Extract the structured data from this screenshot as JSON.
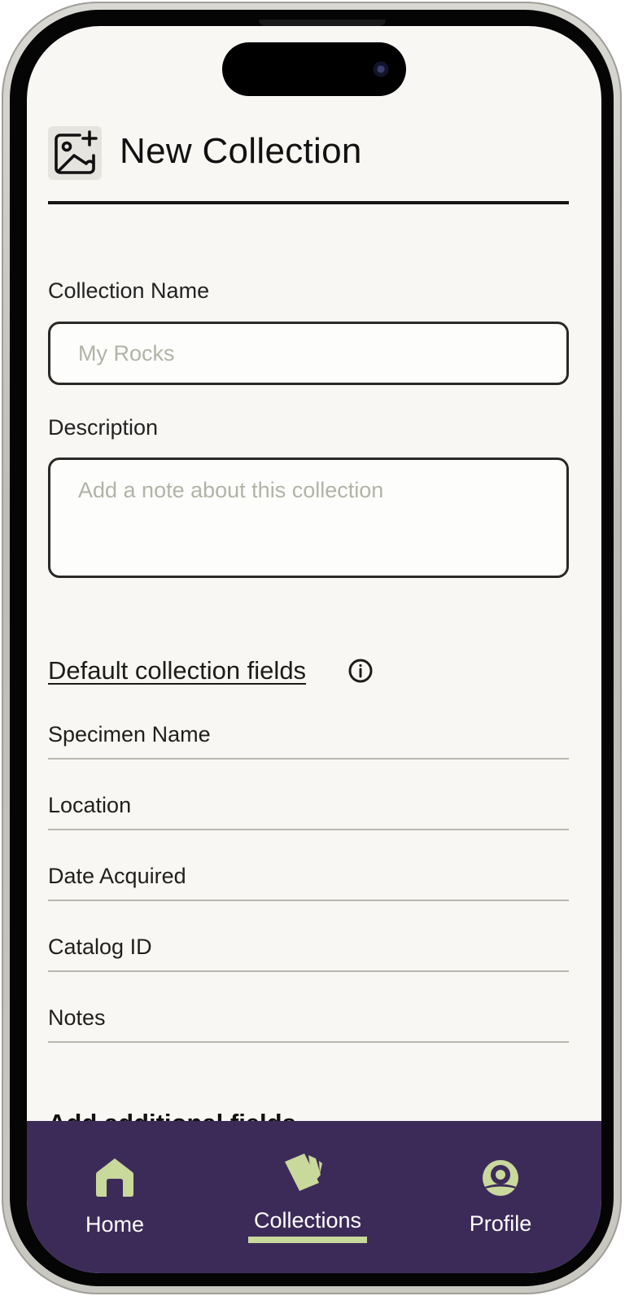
{
  "header": {
    "title": "New Collection",
    "icon": "image-plus-icon"
  },
  "form": {
    "collection_name": {
      "label": "Collection Name",
      "value": "",
      "placeholder": "My Rocks"
    },
    "description": {
      "label": "Description",
      "value": "",
      "placeholder": "Add a note about this collection"
    }
  },
  "default_fields": {
    "title": "Default collection fields",
    "info_icon": "info-icon",
    "items": [
      {
        "label": "Specimen Name"
      },
      {
        "label": "Location"
      },
      {
        "label": "Date Acquired"
      },
      {
        "label": "Catalog ID"
      },
      {
        "label": "Notes"
      }
    ]
  },
  "additional_fields": {
    "title": "Add additional fields"
  },
  "bottom_nav": {
    "active": "Collections",
    "items": [
      {
        "label": "Home",
        "icon": "home-icon"
      },
      {
        "label": "Collections",
        "icon": "cards-icon"
      },
      {
        "label": "Profile",
        "icon": "user-circle-icon"
      }
    ]
  },
  "colors": {
    "nav_background": "#3c2b59",
    "nav_accent": "#c9d89b",
    "screen_background": "#f8f7f4",
    "placeholder": "#b2b3a6"
  }
}
